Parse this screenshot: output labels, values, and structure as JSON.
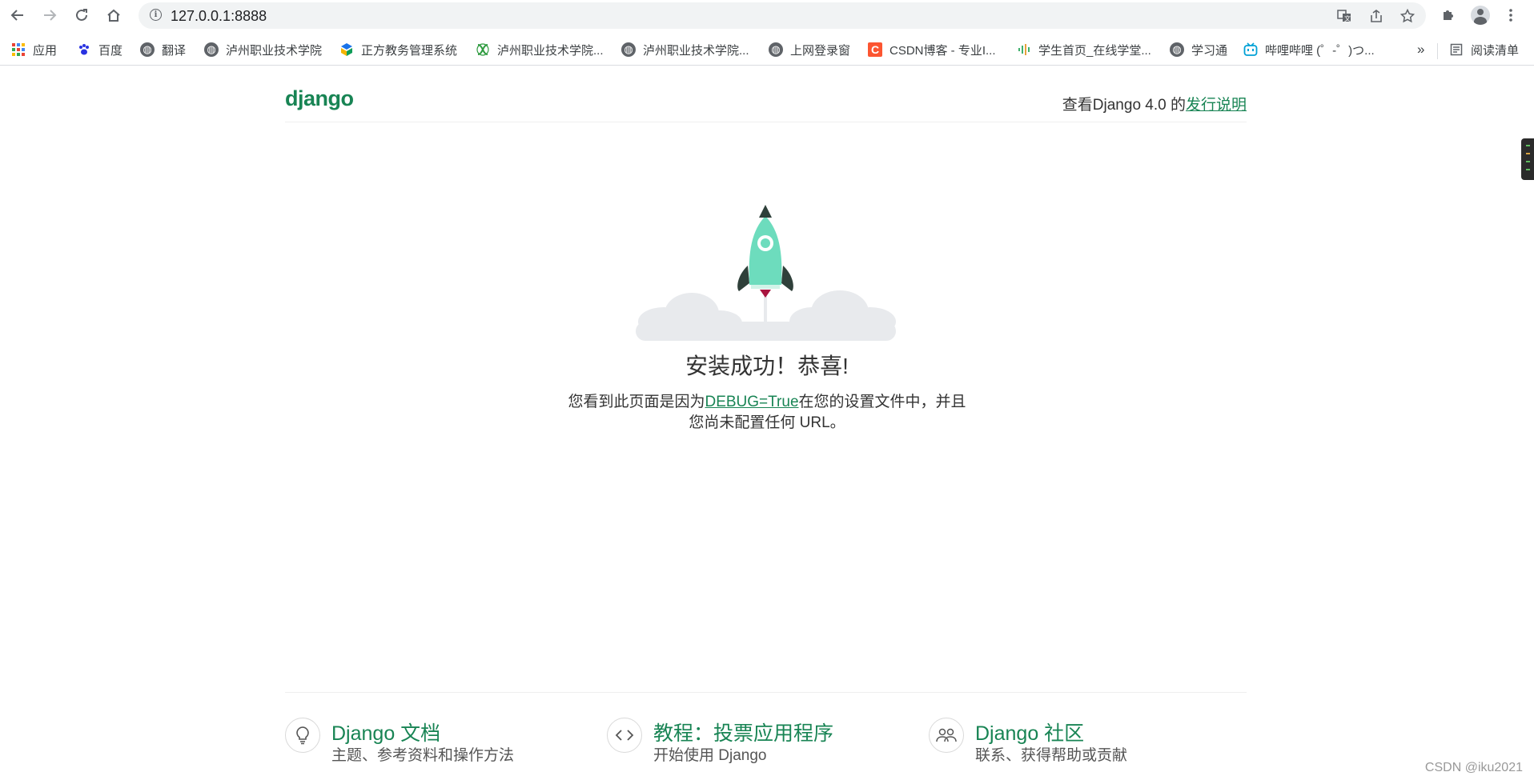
{
  "browser": {
    "url": "127.0.0.1:8888"
  },
  "bookmarks": [
    {
      "label": "应用",
      "icon": "apps-grid-icon"
    },
    {
      "label": "百度",
      "icon": "baidu-paw-icon"
    },
    {
      "label": "翻译",
      "icon": "globe-icon"
    },
    {
      "label": "泸州职业技术学院",
      "icon": "globe-icon"
    },
    {
      "label": "正方教务管理系统",
      "icon": "zfsoft-icon"
    },
    {
      "label": "泸州职业技术学院...",
      "icon": "green-knot-icon"
    },
    {
      "label": "泸州职业技术学院...",
      "icon": "globe-icon"
    },
    {
      "label": "上网登录窗",
      "icon": "globe-icon"
    },
    {
      "label": "CSDN博客 - 专业I...",
      "icon": "csdn-icon"
    },
    {
      "label": "学生首页_在线学堂...",
      "icon": "sound-wave-icon"
    },
    {
      "label": "学习通",
      "icon": "globe-icon"
    },
    {
      "label": "哔哩哔哩 (゜-゜)つ...",
      "icon": "bilibili-icon"
    }
  ],
  "reading_list": "阅读清单",
  "bookmarks_more": "»",
  "page": {
    "logo": "django",
    "release_prefix": "查看Django 4.0 的",
    "release_link": "发行说明",
    "title": "安装成功！恭喜!",
    "subtitle_prefix": "您看到此页面是因为",
    "subtitle_link": "DEBUG=True",
    "subtitle_suffix": "在您的设置文件中，并且",
    "subtitle_line2": "您尚未配置任何 URL。"
  },
  "cards": [
    {
      "title": "Django 文档",
      "desc": "主题、参考资料和操作方法",
      "icon": "lightbulb-icon"
    },
    {
      "title": "教程：投票应用程序",
      "desc": "开始使用 Django",
      "icon": "code-brackets-icon"
    },
    {
      "title": "Django 社区",
      "desc": "联系、获得帮助或贡献",
      "icon": "people-icon"
    }
  ],
  "watermark": "CSDN @iku2021",
  "colors": {
    "django_green": "#188454",
    "rocket_body": "#6ddcbd",
    "rocket_dark": "#2f403a",
    "cloud": "#e8eaed"
  }
}
